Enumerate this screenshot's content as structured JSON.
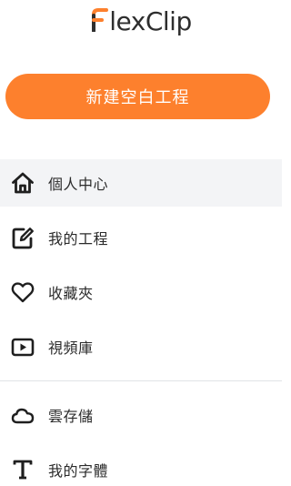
{
  "brand": {
    "logo_text": "lexClip",
    "accent_color": "#fd802d"
  },
  "create_button": {
    "label": "新建空白工程"
  },
  "nav": {
    "items": [
      {
        "label": "個人中心",
        "icon": "home-icon",
        "active": true
      },
      {
        "label": "我的工程",
        "icon": "edit-icon",
        "active": false
      },
      {
        "label": "收藏夾",
        "icon": "heart-icon",
        "active": false
      },
      {
        "label": "視頻庫",
        "icon": "video-play-icon",
        "active": false
      }
    ],
    "secondary_items": [
      {
        "label": "雲存儲",
        "icon": "cloud-icon",
        "active": false
      },
      {
        "label": "我的字體",
        "icon": "text-font-icon",
        "active": false
      }
    ]
  }
}
